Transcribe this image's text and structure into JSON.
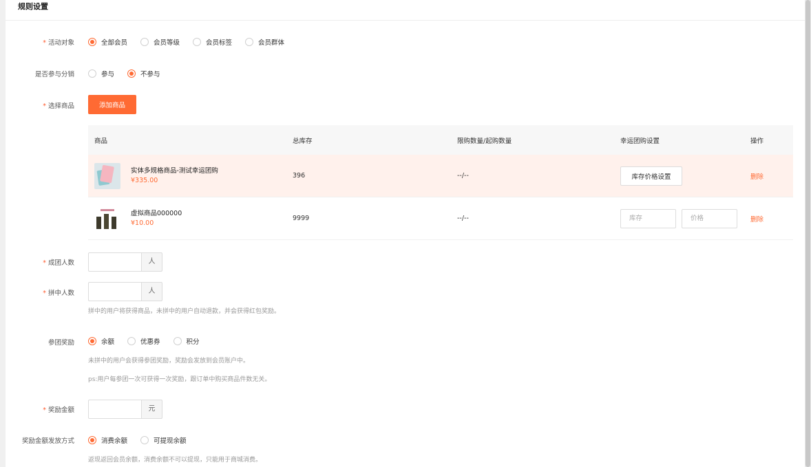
{
  "section_title": "规则设置",
  "activity_target": {
    "label": "活动对象",
    "required_mark": "*",
    "options": [
      "全部会员",
      "会员等级",
      "会员标签",
      "会员群体"
    ],
    "selected": "全部会员"
  },
  "distribution": {
    "label": "是否参与分销",
    "options": [
      "参与",
      "不参与"
    ],
    "selected": "不参与"
  },
  "select_goods": {
    "label": "选择商品",
    "required_mark": "*",
    "add_button": "添加商品"
  },
  "goods_table": {
    "headers": [
      "商品",
      "总库存",
      "限购数量/起购数量",
      "幸运团购设置",
      "操作"
    ],
    "rows": [
      {
        "name": "实体多规格商品-测试幸运团购",
        "price": "¥335.00",
        "stock": "396",
        "limit": "--/--",
        "setting_button": "库存价格设置",
        "op": "删除"
      },
      {
        "name": "虚拟商品000000",
        "price": "¥10.00",
        "stock": "9999",
        "limit": "--/--",
        "stock_placeholder": "库存",
        "price_placeholder": "价格",
        "op": "删除"
      }
    ]
  },
  "group_size": {
    "label": "成团人数",
    "required_mark": "*",
    "unit": "人",
    "value": ""
  },
  "winner_count": {
    "label": "拼中人数",
    "required_mark": "*",
    "unit": "人",
    "value": "",
    "hint": "拼中的用户将获得商品，未拼中的用户自动退款，并会获得红包奖励。"
  },
  "join_reward": {
    "label": "参团奖励",
    "options": [
      "余额",
      "优惠券",
      "积分"
    ],
    "selected": "余额",
    "hint1": "未拼中的用户会获得参团奖励，奖励会发放到会员账户中。",
    "hint2": "ps:用户每参团一次可获得一次奖励，跟订单中购买商品件数无关。"
  },
  "reward_amount": {
    "label": "奖励金额",
    "required_mark": "*",
    "unit": "元",
    "value": ""
  },
  "reward_method": {
    "label": "奖励金额发放方式",
    "options": [
      "消费余额",
      "可提现余额"
    ],
    "selected": "消费余额",
    "hint": "返现返回会员余额，消费余额不可以提现，只能用于商城消费。"
  },
  "colors": {
    "accent": "#ff6a33",
    "highlight_row": "#fff1ec"
  }
}
